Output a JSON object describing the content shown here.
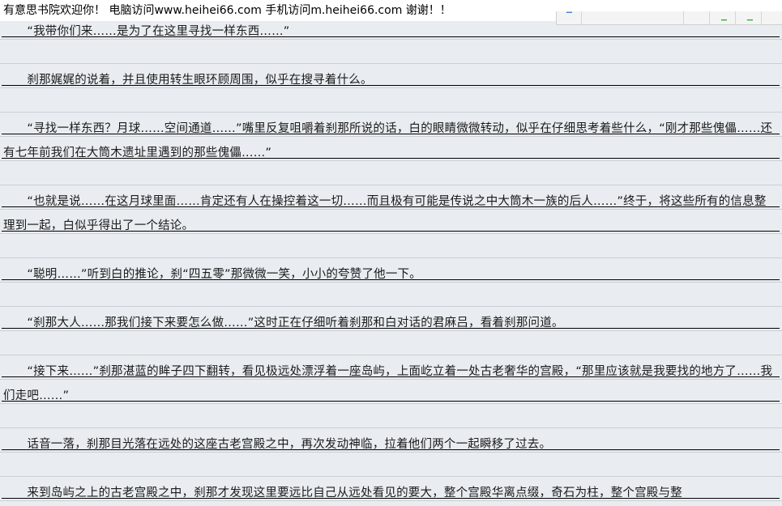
{
  "header": {
    "banner": "有意思书院欢迎你！ 电脑访问www.heihei66.com   手机访问m.heihei66.com  谢谢！！"
  },
  "toolbar": {
    "buttons": [
      "toolbar-button-1",
      "toolbar-button-2",
      "toolbar-button-3",
      "toolbar-button-4",
      "toolbar-button-5"
    ]
  },
  "content": {
    "paragraphs": [
      "　　“我带你们来……是为了在这里寻找一样东西……”",
      "　　刹那娓娓的说着，并且使用转生眼环顾周围，似乎在搜寻着什么。",
      "　　“寻找一样东西？月球……空间通道……”嘴里反复咀嚼着刹那所说的话，白的眼睛微微转动，似乎在仔细思考着些什么，“刚才那些傀儡……还有七年前我们在大筒木遗址里遇到的那些傀儡……”",
      "　　“也就是说……在这月球里面……肯定还有人在操控着这一切……而且极有可能是传说之中大筒木一族的后人……”终于，将这些所有的信息整理到一起，白似乎得出了一个结论。",
      "　　“聪明……”听到白的推论，刹“四五零”那微微一笑，小小的夸赞了他一下。",
      "　　“刹那大人……那我们接下来要怎么做……”这时正在仔细听着刹那和白对话的君麻吕，看着刹那问道。",
      "　　“接下来……”刹那湛蓝的眸子四下翻转，看见极远处漂浮着一座岛屿，上面屹立着一处古老奢华的宫殿，“那里应该就是我要找的地方了……我们走吧……”",
      "　　话音一落，刹那目光落在远处的这座古老宫殿之中，再次发动神临，拉着他们两个一起瞬移了过去。",
      "　　来到岛屿之上的古老宫殿之中，刹那才发现这里要远比自己从远处看见的要大，整个宫殿华离点缀，奇石为柱，整个宫殿与整"
    ]
  }
}
